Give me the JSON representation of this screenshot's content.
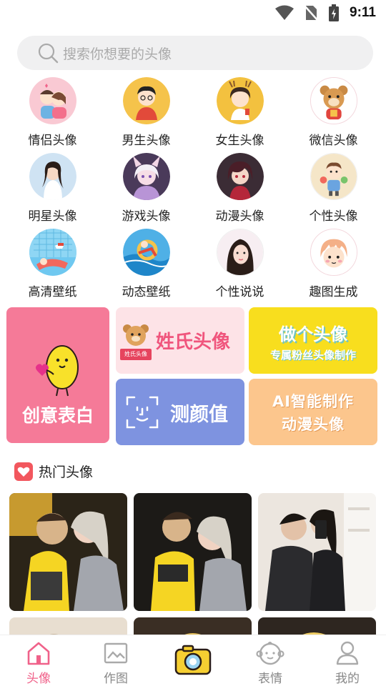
{
  "status_bar": {
    "time": "9:11"
  },
  "search": {
    "placeholder": "搜索你想要的头像"
  },
  "categories": [
    {
      "label": "情侣头像",
      "icon": "couple-avatar-icon"
    },
    {
      "label": "男生头像",
      "icon": "boy-avatar-icon"
    },
    {
      "label": "女生头像",
      "icon": "girl-avatar-icon"
    },
    {
      "label": "微信头像",
      "icon": "bear-avatar-icon"
    },
    {
      "label": "明星头像",
      "icon": "star-avatar-icon"
    },
    {
      "label": "游戏头像",
      "icon": "game-avatar-icon"
    },
    {
      "label": "动漫头像",
      "icon": "anime-avatar-icon"
    },
    {
      "label": "个性头像",
      "icon": "personality-avatar-icon"
    },
    {
      "label": "高清壁纸",
      "icon": "hd-wallpaper-icon"
    },
    {
      "label": "动态壁纸",
      "icon": "live-wallpaper-icon"
    },
    {
      "label": "个性说说",
      "icon": "status-post-icon"
    },
    {
      "label": "趣图生成",
      "icon": "fun-image-icon"
    }
  ],
  "features": {
    "confess": "创意表白",
    "surname": "姓氏头像",
    "surname_badge": "姓氏头像",
    "make_title": "做个头像",
    "make_sub": "专属粉丝头像制作",
    "face": "测颜值",
    "ai_line1": "AI智能制作",
    "ai_line2": "动漫头像"
  },
  "section": {
    "title": "热门头像"
  },
  "bottom_nav": [
    {
      "label": "头像",
      "active": true
    },
    {
      "label": "作图",
      "active": false
    },
    {
      "label": "",
      "active": false
    },
    {
      "label": "表情",
      "active": false
    },
    {
      "label": "我的",
      "active": false
    }
  ],
  "colors": {
    "accent": "#f0628a",
    "confess_tile": "#f57a98",
    "surname_tile": "#fde3e7",
    "make_tile": "#f8de1e",
    "face_tile": "#7e93e0",
    "ai_tile": "#fcc68d"
  }
}
